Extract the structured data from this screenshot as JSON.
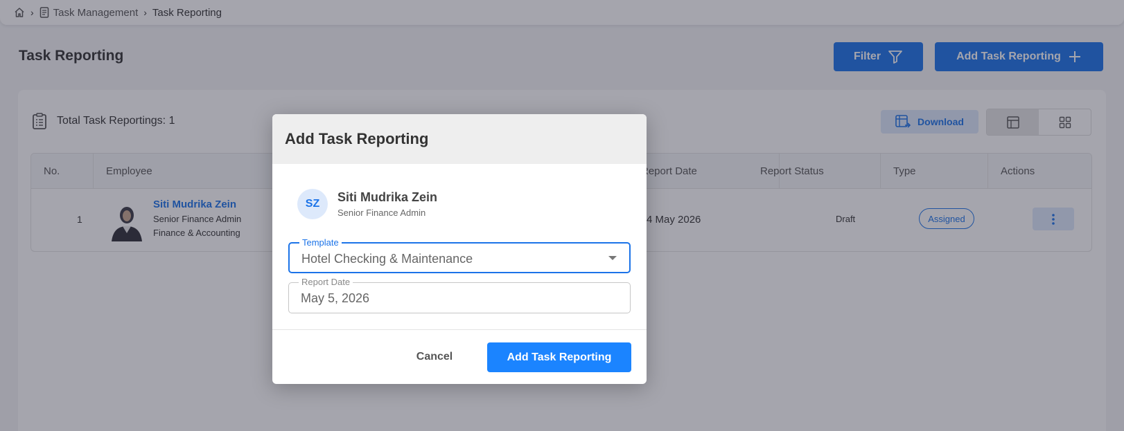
{
  "breadcrumb": {
    "items": [
      {
        "label": ""
      },
      {
        "label": "Task Management"
      },
      {
        "label": "Task Reporting"
      }
    ]
  },
  "page": {
    "title": "Task Reporting",
    "filter_label": "Filter",
    "add_label": "Add Task Reporting"
  },
  "summary": {
    "total_label": "Total Task Reportings: 1",
    "download_label": "Download"
  },
  "table": {
    "columns": [
      "No.",
      "Employee",
      "Report Date",
      "Report Status",
      "Type",
      "Actions"
    ],
    "rows": [
      {
        "no": "1",
        "employee_name": "Siti Mudrika Zein",
        "employee_role": "Senior Finance Admin",
        "employee_dept": "Finance & Accounting",
        "report_date": "4 May 2026",
        "status": "Draft",
        "type": "Assigned"
      }
    ]
  },
  "modal": {
    "title": "Add Task Reporting",
    "employee": {
      "initials": "SZ",
      "name": "Siti Mudrika Zein",
      "role": "Senior Finance Admin"
    },
    "template": {
      "label": "Template",
      "value": "Hotel Checking & Maintenance"
    },
    "report_date": {
      "label": "Report Date",
      "value": "May 5, 2026"
    },
    "cancel_label": "Cancel",
    "submit_label": "Add Task Reporting"
  },
  "colors": {
    "primary": "#1b73e8",
    "submit": "#1b84ff",
    "overlay": "#28283c"
  },
  "icons": [
    "home-icon",
    "document-icon",
    "chevron-right-icon",
    "filter-icon",
    "plus-icon",
    "clipboard-icon",
    "spreadsheet-export-icon",
    "table-view-icon",
    "grid-view-icon",
    "more-vertical-icon",
    "dropdown-caret-icon"
  ]
}
